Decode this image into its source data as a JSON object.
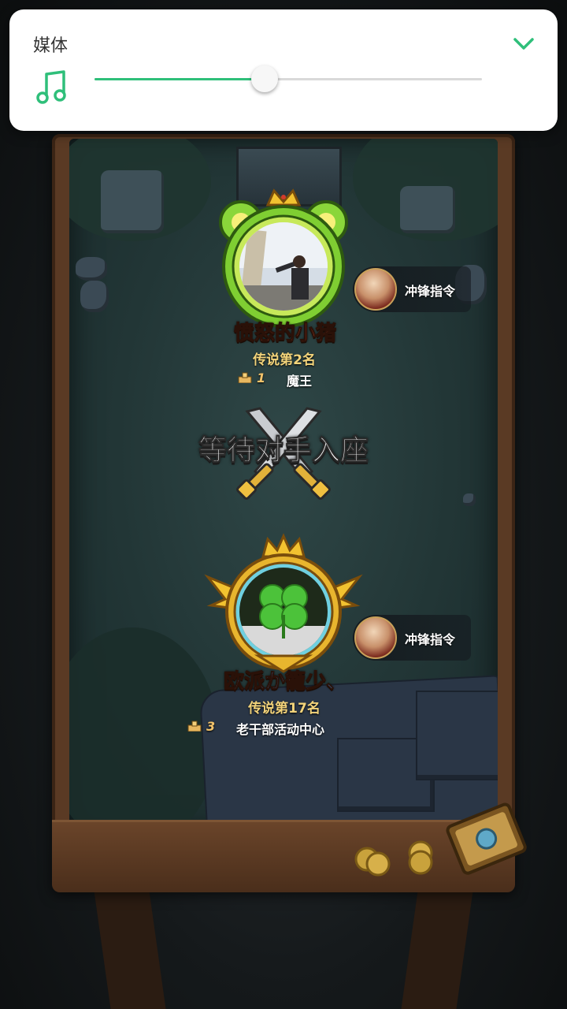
{
  "volume": {
    "title": "媒体",
    "level_percent": 44,
    "icons": {
      "media": "music-note-icon",
      "collapse": "chevron-down-icon"
    },
    "accent_color": "#2fbf7a"
  },
  "match": {
    "status_text": "等待对手入座",
    "top_player": {
      "name": "愤怒的小猪",
      "name_color": "#ff5a3a",
      "rank": "传说第2名",
      "trophy_count": "1",
      "title": "魔王",
      "skill": "冲锋指令"
    },
    "bottom_player": {
      "name": "欧派か籠少、",
      "name_color": "#4aa8ff",
      "rank": "传说第17名",
      "trophy_count": "3",
      "title": "老干部活动中心",
      "skill": "冲锋指令"
    }
  }
}
